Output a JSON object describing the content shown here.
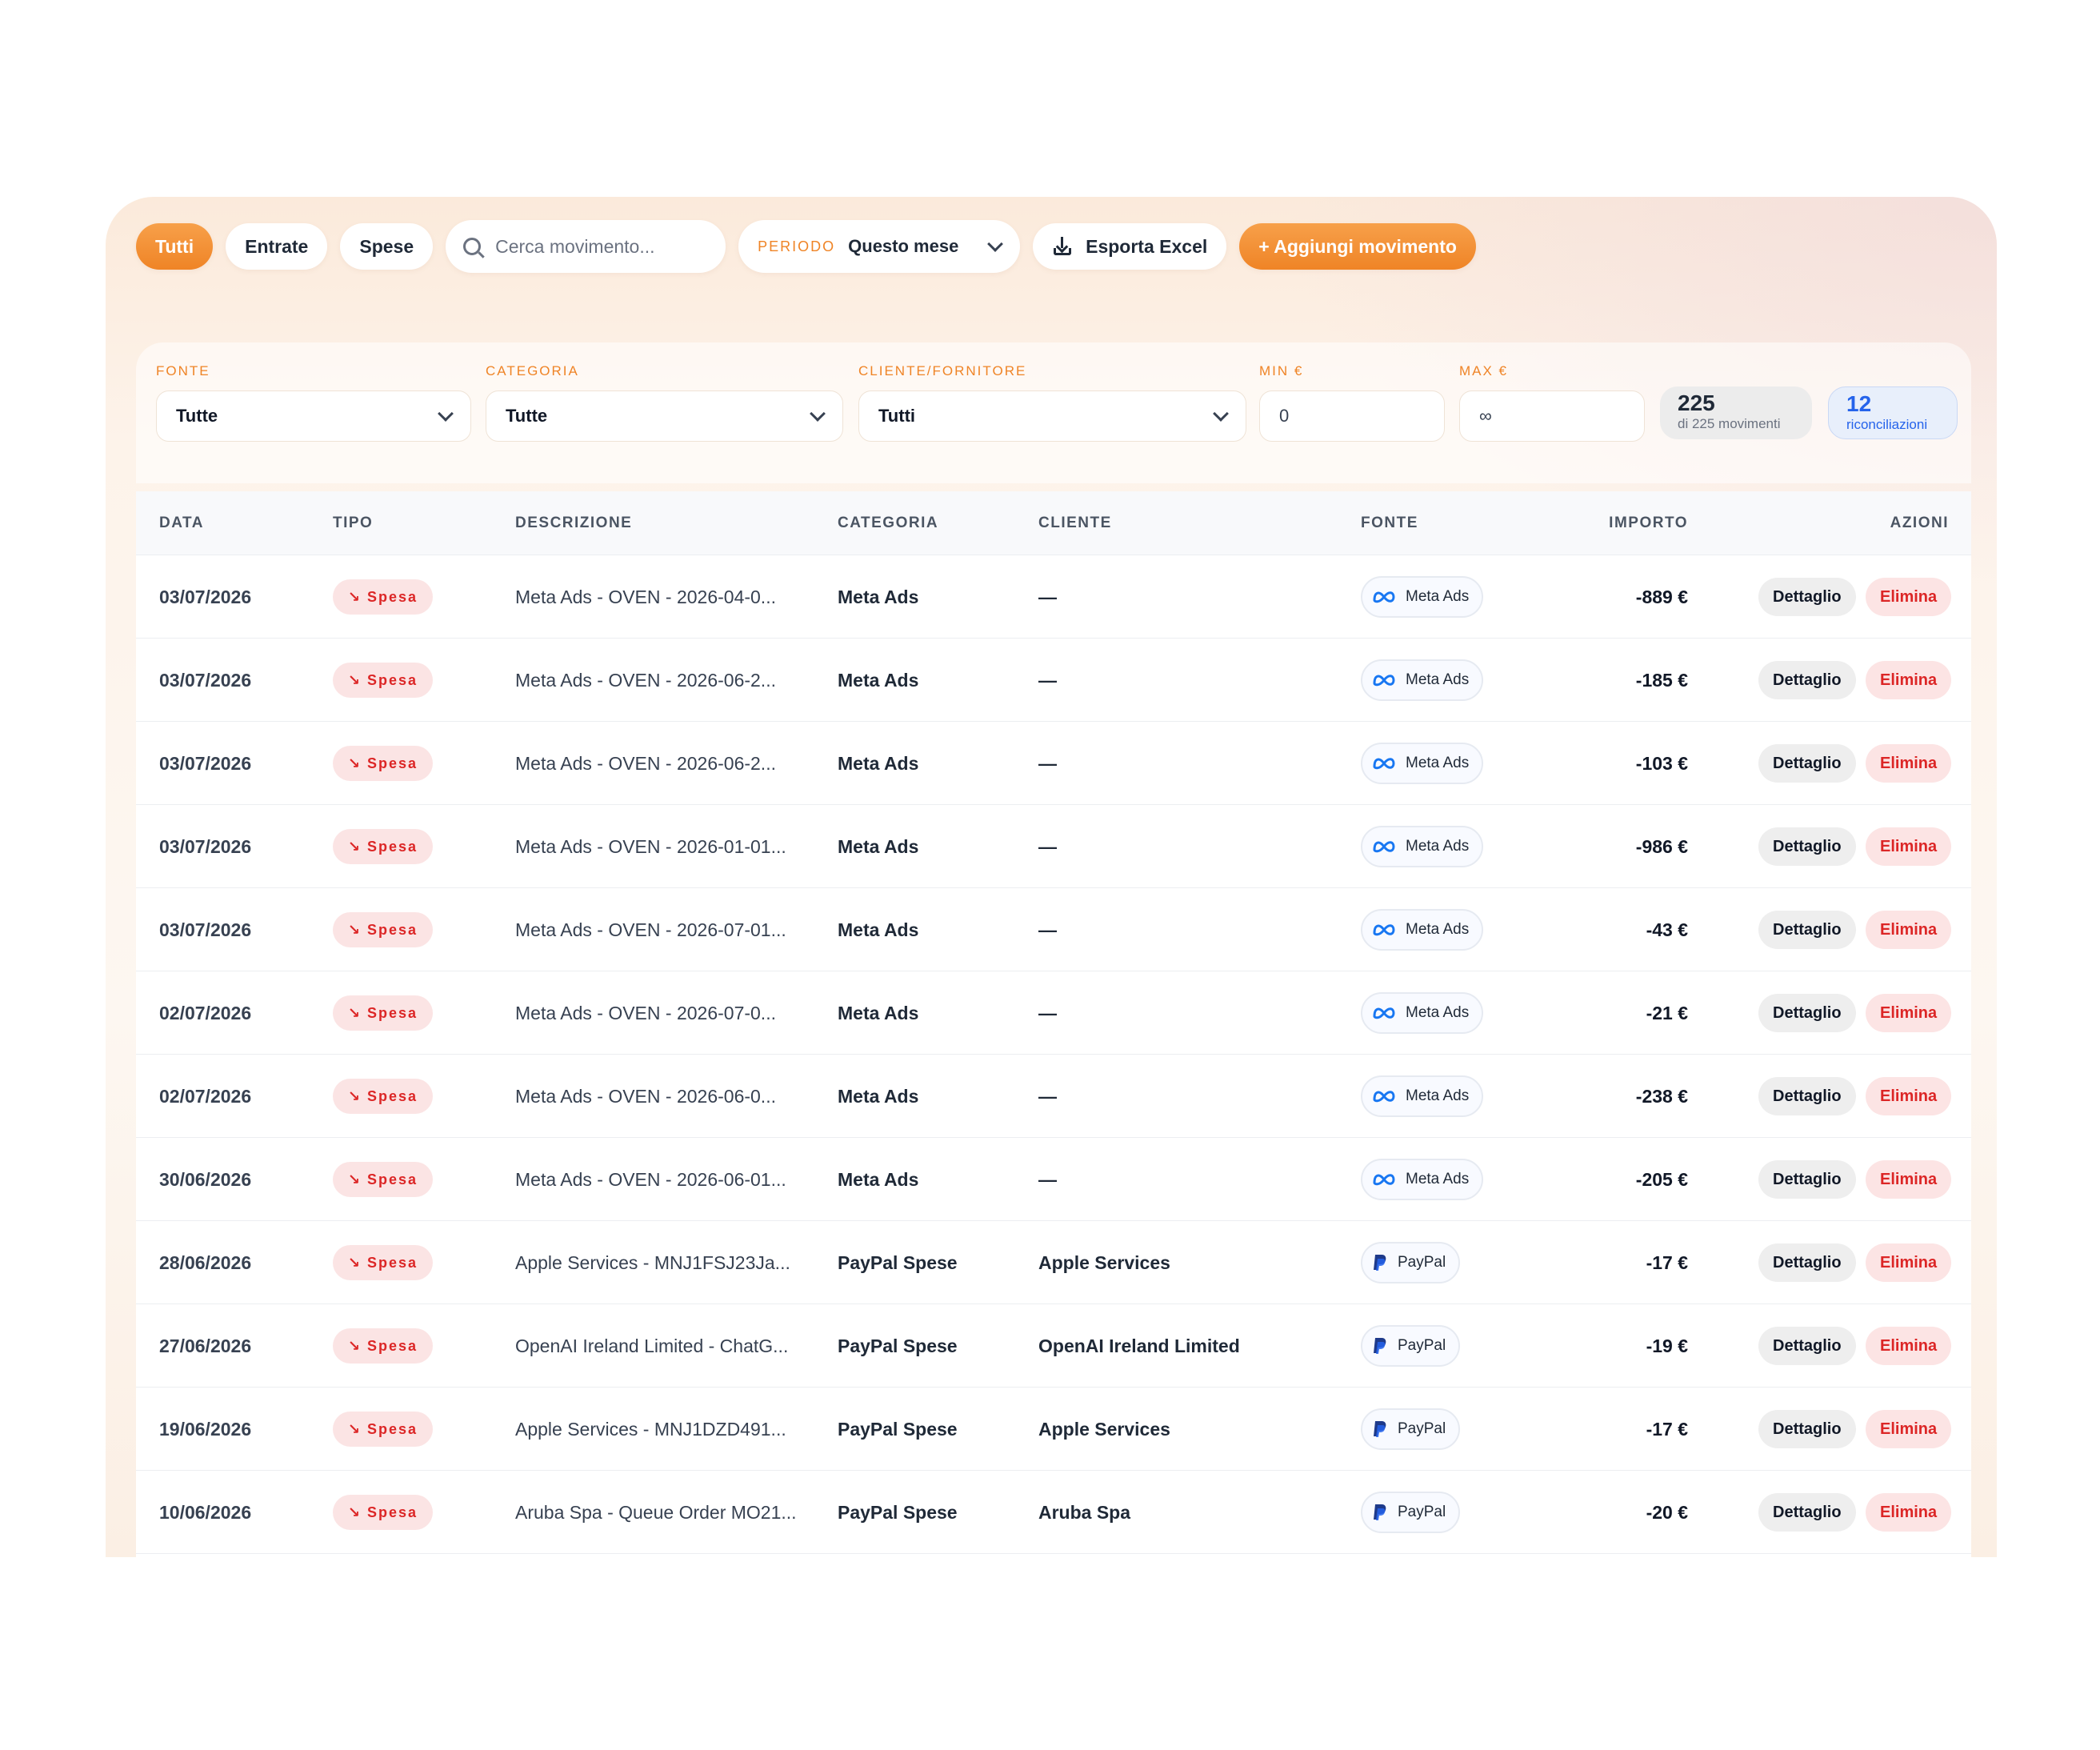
{
  "toolbar": {
    "tabs": [
      {
        "label": "Tutti",
        "active": true
      },
      {
        "label": "Entrate",
        "active": false
      },
      {
        "label": "Spese",
        "active": false
      }
    ],
    "search_placeholder": "Cerca movimento...",
    "period_label": "PERIODO",
    "period_value": "Questo mese",
    "export_label": "Esporta Excel",
    "add_label": "+ Aggiungi movimento"
  },
  "filters": {
    "fonte": {
      "label": "FONTE",
      "value": "Tutte"
    },
    "categoria": {
      "label": "CATEGORIA",
      "value": "Tutte"
    },
    "cliente": {
      "label": "CLIENTE/FORNITORE",
      "value": "Tutti"
    },
    "min": {
      "label": "MIN €",
      "value": "0"
    },
    "max": {
      "label": "MAX €",
      "value": "∞"
    }
  },
  "stats": {
    "count": "225",
    "count_sub": "di 225 movimenti",
    "recon": "12",
    "recon_sub": "riconciliazioni"
  },
  "table": {
    "headers": {
      "data": "DATA",
      "tipo": "TIPO",
      "descrizione": "DESCRIZIONE",
      "categoria": "CATEGORIA",
      "cliente": "CLIENTE",
      "fonte": "FONTE",
      "importo": "IMPORTO",
      "azioni": "AZIONI"
    },
    "detail_label": "Dettaglio",
    "delete_label": "Elimina",
    "rows": [
      {
        "date": "03/07/2026",
        "tipo": "Spesa",
        "desc": "Meta Ads - OVEN - 2026-04-0...",
        "cat": "Meta Ads",
        "cli": "—",
        "fonte": "Meta Ads",
        "fonte_icon": "meta-icon",
        "imp": "-889 €"
      },
      {
        "date": "03/07/2026",
        "tipo": "Spesa",
        "desc": "Meta Ads - OVEN - 2026-06-2...",
        "cat": "Meta Ads",
        "cli": "—",
        "fonte": "Meta Ads",
        "fonte_icon": "meta-icon",
        "imp": "-185 €"
      },
      {
        "date": "03/07/2026",
        "tipo": "Spesa",
        "desc": "Meta Ads - OVEN - 2026-06-2...",
        "cat": "Meta Ads",
        "cli": "—",
        "fonte": "Meta Ads",
        "fonte_icon": "meta-icon",
        "imp": "-103 €"
      },
      {
        "date": "03/07/2026",
        "tipo": "Spesa",
        "desc": "Meta Ads - OVEN - 2026-01-01...",
        "cat": "Meta Ads",
        "cli": "—",
        "fonte": "Meta Ads",
        "fonte_icon": "meta-icon",
        "imp": "-986 €"
      },
      {
        "date": "03/07/2026",
        "tipo": "Spesa",
        "desc": "Meta Ads - OVEN - 2026-07-01...",
        "cat": "Meta Ads",
        "cli": "—",
        "fonte": "Meta Ads",
        "fonte_icon": "meta-icon",
        "imp": "-43 €"
      },
      {
        "date": "02/07/2026",
        "tipo": "Spesa",
        "desc": "Meta Ads - OVEN - 2026-07-0...",
        "cat": "Meta Ads",
        "cli": "—",
        "fonte": "Meta Ads",
        "fonte_icon": "meta-icon",
        "imp": "-21 €"
      },
      {
        "date": "02/07/2026",
        "tipo": "Spesa",
        "desc": "Meta Ads - OVEN - 2026-06-0...",
        "cat": "Meta Ads",
        "cli": "—",
        "fonte": "Meta Ads",
        "fonte_icon": "meta-icon",
        "imp": "-238 €"
      },
      {
        "date": "30/06/2026",
        "tipo": "Spesa",
        "desc": "Meta Ads - OVEN - 2026-06-01...",
        "cat": "Meta Ads",
        "cli": "—",
        "fonte": "Meta Ads",
        "fonte_icon": "meta-icon",
        "imp": "-205 €"
      },
      {
        "date": "28/06/2026",
        "tipo": "Spesa",
        "desc": "Apple Services - MNJ1FSJ23Ja...",
        "cat": "PayPal Spese",
        "cli": "Apple Services",
        "fonte": "PayPal",
        "fonte_icon": "paypal-icon",
        "imp": "-17 €"
      },
      {
        "date": "27/06/2026",
        "tipo": "Spesa",
        "desc": "OpenAI Ireland Limited - ChatG...",
        "cat": "PayPal Spese",
        "cli": "OpenAI Ireland Limited",
        "fonte": "PayPal",
        "fonte_icon": "paypal-icon",
        "imp": "-19 €"
      },
      {
        "date": "19/06/2026",
        "tipo": "Spesa",
        "desc": "Apple Services - MNJ1DZD491...",
        "cat": "PayPal Spese",
        "cli": "Apple Services",
        "fonte": "PayPal",
        "fonte_icon": "paypal-icon",
        "imp": "-17 €"
      },
      {
        "date": "10/06/2026",
        "tipo": "Spesa",
        "desc": "Aruba Spa - Queue Order MO21...",
        "cat": "PayPal Spese",
        "cli": "Aruba Spa",
        "fonte": "PayPal",
        "fonte_icon": "paypal-icon",
        "imp": "-20 €"
      }
    ]
  },
  "colors": {
    "accent": "#ef8426",
    "danger": "#dc2626",
    "info": "#2563eb"
  }
}
